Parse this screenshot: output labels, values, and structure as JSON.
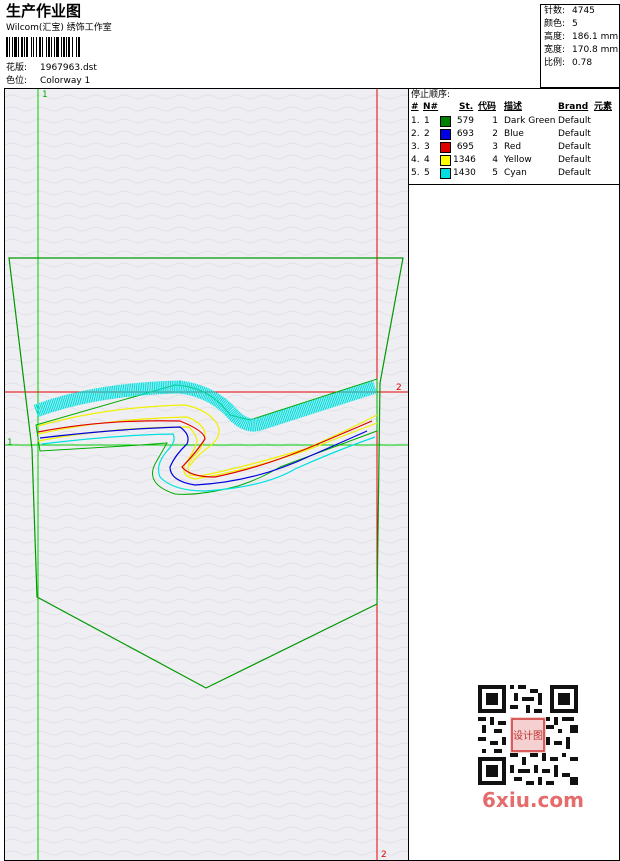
{
  "header": {
    "title": "生产作业图",
    "company": "Wilcom(汇宝) 绣饰工作室",
    "design_label": "花版:",
    "design_value": "1967963.dst",
    "colorway_label": "色位:",
    "colorway_value": "Colorway 1"
  },
  "stats": [
    {
      "label": "针数:",
      "value": "4745"
    },
    {
      "label": "颜色:",
      "value": "5"
    },
    {
      "label": "高度:",
      "value": "186.1 mm"
    },
    {
      "label": "宽度:",
      "value": "170.8 mm"
    },
    {
      "label": "比例:",
      "value": "0.78"
    }
  ],
  "stop_table": {
    "title": "停止顺序:",
    "headers": {
      "order": "#",
      "needle": "N#",
      "stitches": "St.",
      "code": "代码",
      "description": "描述",
      "brand": "Brand",
      "element": "元素"
    },
    "rows": [
      {
        "order": "1.",
        "needle": "1",
        "color": "#008000",
        "stitches": "579",
        "code": "1",
        "description": "Dark Green",
        "brand": "Default"
      },
      {
        "order": "2.",
        "needle": "2",
        "color": "#0000e0",
        "stitches": "693",
        "code": "2",
        "description": "Blue",
        "brand": "Default"
      },
      {
        "order": "3.",
        "needle": "3",
        "color": "#e00000",
        "stitches": "695",
        "code": "3",
        "description": "Red",
        "brand": "Default"
      },
      {
        "order": "4.",
        "needle": "4",
        "color": "#ffff00",
        "stitches": "1346",
        "code": "4",
        "description": "Yellow",
        "brand": "Default"
      },
      {
        "order": "5.",
        "needle": "5",
        "color": "#00e0e0",
        "stitches": "1430",
        "code": "5",
        "description": "Cyan",
        "brand": "Default"
      }
    ]
  },
  "guides": {
    "green_v_top": "1",
    "green_h_left": "1",
    "red_h_right": "2",
    "red_v_bottom": "2"
  },
  "watermark": {
    "qr_label": "设计图",
    "text": "6xiu.com"
  },
  "colors": {
    "dark_green": "#008000",
    "blue": "#0000e0",
    "red": "#e00000",
    "yellow": "#ffff00",
    "cyan": "#00e0e0"
  }
}
